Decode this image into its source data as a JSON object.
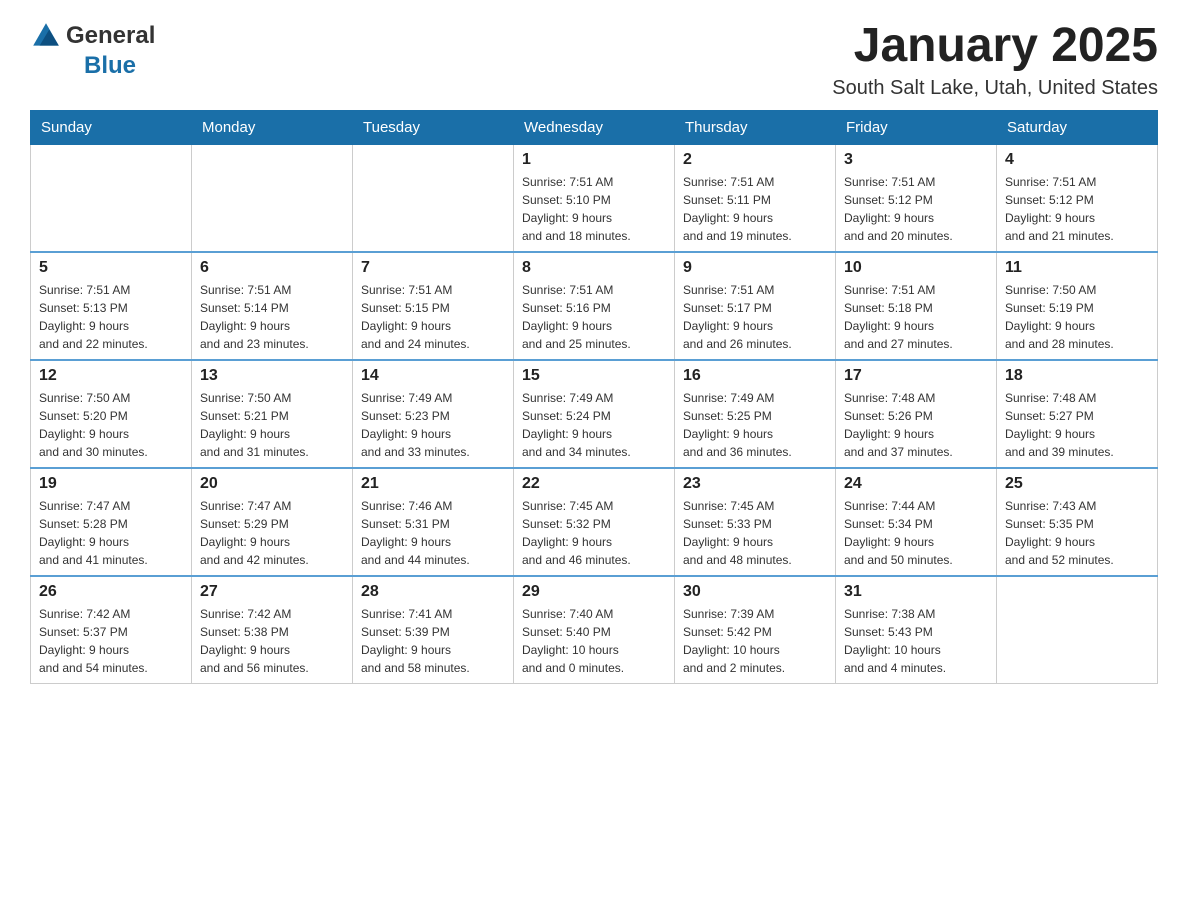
{
  "header": {
    "logo": {
      "text_general": "General",
      "text_blue": "Blue",
      "aria": "GeneralBlue Logo"
    },
    "title": "January 2025",
    "location": "South Salt Lake, Utah, United States"
  },
  "weekdays": [
    "Sunday",
    "Monday",
    "Tuesday",
    "Wednesday",
    "Thursday",
    "Friday",
    "Saturday"
  ],
  "weeks": [
    [
      {
        "day": "",
        "sunrise": "",
        "sunset": "",
        "daylight": ""
      },
      {
        "day": "",
        "sunrise": "",
        "sunset": "",
        "daylight": ""
      },
      {
        "day": "",
        "sunrise": "",
        "sunset": "",
        "daylight": ""
      },
      {
        "day": "1",
        "sunrise": "Sunrise: 7:51 AM",
        "sunset": "Sunset: 5:10 PM",
        "daylight": "Daylight: 9 hours and 18 minutes."
      },
      {
        "day": "2",
        "sunrise": "Sunrise: 7:51 AM",
        "sunset": "Sunset: 5:11 PM",
        "daylight": "Daylight: 9 hours and 19 minutes."
      },
      {
        "day": "3",
        "sunrise": "Sunrise: 7:51 AM",
        "sunset": "Sunset: 5:12 PM",
        "daylight": "Daylight: 9 hours and 20 minutes."
      },
      {
        "day": "4",
        "sunrise": "Sunrise: 7:51 AM",
        "sunset": "Sunset: 5:12 PM",
        "daylight": "Daylight: 9 hours and 21 minutes."
      }
    ],
    [
      {
        "day": "5",
        "sunrise": "Sunrise: 7:51 AM",
        "sunset": "Sunset: 5:13 PM",
        "daylight": "Daylight: 9 hours and 22 minutes."
      },
      {
        "day": "6",
        "sunrise": "Sunrise: 7:51 AM",
        "sunset": "Sunset: 5:14 PM",
        "daylight": "Daylight: 9 hours and 23 minutes."
      },
      {
        "day": "7",
        "sunrise": "Sunrise: 7:51 AM",
        "sunset": "Sunset: 5:15 PM",
        "daylight": "Daylight: 9 hours and 24 minutes."
      },
      {
        "day": "8",
        "sunrise": "Sunrise: 7:51 AM",
        "sunset": "Sunset: 5:16 PM",
        "daylight": "Daylight: 9 hours and 25 minutes."
      },
      {
        "day": "9",
        "sunrise": "Sunrise: 7:51 AM",
        "sunset": "Sunset: 5:17 PM",
        "daylight": "Daylight: 9 hours and 26 minutes."
      },
      {
        "day": "10",
        "sunrise": "Sunrise: 7:51 AM",
        "sunset": "Sunset: 5:18 PM",
        "daylight": "Daylight: 9 hours and 27 minutes."
      },
      {
        "day": "11",
        "sunrise": "Sunrise: 7:50 AM",
        "sunset": "Sunset: 5:19 PM",
        "daylight": "Daylight: 9 hours and 28 minutes."
      }
    ],
    [
      {
        "day": "12",
        "sunrise": "Sunrise: 7:50 AM",
        "sunset": "Sunset: 5:20 PM",
        "daylight": "Daylight: 9 hours and 30 minutes."
      },
      {
        "day": "13",
        "sunrise": "Sunrise: 7:50 AM",
        "sunset": "Sunset: 5:21 PM",
        "daylight": "Daylight: 9 hours and 31 minutes."
      },
      {
        "day": "14",
        "sunrise": "Sunrise: 7:49 AM",
        "sunset": "Sunset: 5:23 PM",
        "daylight": "Daylight: 9 hours and 33 minutes."
      },
      {
        "day": "15",
        "sunrise": "Sunrise: 7:49 AM",
        "sunset": "Sunset: 5:24 PM",
        "daylight": "Daylight: 9 hours and 34 minutes."
      },
      {
        "day": "16",
        "sunrise": "Sunrise: 7:49 AM",
        "sunset": "Sunset: 5:25 PM",
        "daylight": "Daylight: 9 hours and 36 minutes."
      },
      {
        "day": "17",
        "sunrise": "Sunrise: 7:48 AM",
        "sunset": "Sunset: 5:26 PM",
        "daylight": "Daylight: 9 hours and 37 minutes."
      },
      {
        "day": "18",
        "sunrise": "Sunrise: 7:48 AM",
        "sunset": "Sunset: 5:27 PM",
        "daylight": "Daylight: 9 hours and 39 minutes."
      }
    ],
    [
      {
        "day": "19",
        "sunrise": "Sunrise: 7:47 AM",
        "sunset": "Sunset: 5:28 PM",
        "daylight": "Daylight: 9 hours and 41 minutes."
      },
      {
        "day": "20",
        "sunrise": "Sunrise: 7:47 AM",
        "sunset": "Sunset: 5:29 PM",
        "daylight": "Daylight: 9 hours and 42 minutes."
      },
      {
        "day": "21",
        "sunrise": "Sunrise: 7:46 AM",
        "sunset": "Sunset: 5:31 PM",
        "daylight": "Daylight: 9 hours and 44 minutes."
      },
      {
        "day": "22",
        "sunrise": "Sunrise: 7:45 AM",
        "sunset": "Sunset: 5:32 PM",
        "daylight": "Daylight: 9 hours and 46 minutes."
      },
      {
        "day": "23",
        "sunrise": "Sunrise: 7:45 AM",
        "sunset": "Sunset: 5:33 PM",
        "daylight": "Daylight: 9 hours and 48 minutes."
      },
      {
        "day": "24",
        "sunrise": "Sunrise: 7:44 AM",
        "sunset": "Sunset: 5:34 PM",
        "daylight": "Daylight: 9 hours and 50 minutes."
      },
      {
        "day": "25",
        "sunrise": "Sunrise: 7:43 AM",
        "sunset": "Sunset: 5:35 PM",
        "daylight": "Daylight: 9 hours and 52 minutes."
      }
    ],
    [
      {
        "day": "26",
        "sunrise": "Sunrise: 7:42 AM",
        "sunset": "Sunset: 5:37 PM",
        "daylight": "Daylight: 9 hours and 54 minutes."
      },
      {
        "day": "27",
        "sunrise": "Sunrise: 7:42 AM",
        "sunset": "Sunset: 5:38 PM",
        "daylight": "Daylight: 9 hours and 56 minutes."
      },
      {
        "day": "28",
        "sunrise": "Sunrise: 7:41 AM",
        "sunset": "Sunset: 5:39 PM",
        "daylight": "Daylight: 9 hours and 58 minutes."
      },
      {
        "day": "29",
        "sunrise": "Sunrise: 7:40 AM",
        "sunset": "Sunset: 5:40 PM",
        "daylight": "Daylight: 10 hours and 0 minutes."
      },
      {
        "day": "30",
        "sunrise": "Sunrise: 7:39 AM",
        "sunset": "Sunset: 5:42 PM",
        "daylight": "Daylight: 10 hours and 2 minutes."
      },
      {
        "day": "31",
        "sunrise": "Sunrise: 7:38 AM",
        "sunset": "Sunset: 5:43 PM",
        "daylight": "Daylight: 10 hours and 4 minutes."
      },
      {
        "day": "",
        "sunrise": "",
        "sunset": "",
        "daylight": ""
      }
    ]
  ]
}
